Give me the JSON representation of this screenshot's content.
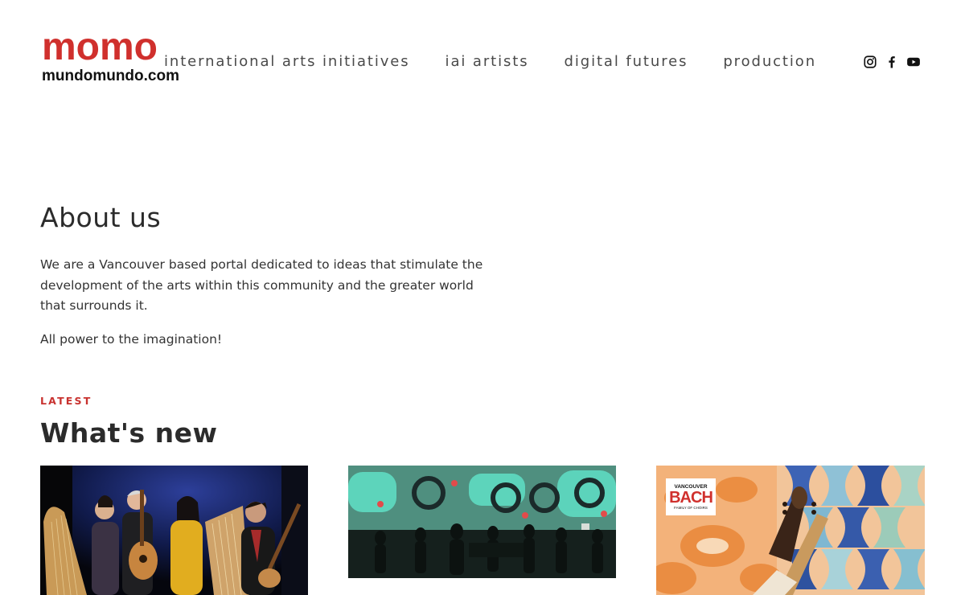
{
  "header": {
    "logo_mark": "momo",
    "logo_sub": "mundomundo.com",
    "nav": [
      {
        "label": "international arts initiatives"
      },
      {
        "label": "iai artists"
      },
      {
        "label": "digital futures"
      },
      {
        "label": "production"
      }
    ],
    "social": [
      {
        "icon": "instagram-icon"
      },
      {
        "icon": "facebook-icon"
      },
      {
        "icon": "youtube-icon"
      }
    ]
  },
  "about": {
    "title": "About us",
    "body": "We are a Vancouver based portal dedicated to ideas that stimulate the development of the arts within this community and the greater world that surrounds it.",
    "slogan": "All power to the imagination!"
  },
  "latest": {
    "eyebrow": "LATEST",
    "title": "What's new",
    "cards": [
      {
        "image": "musicians-with-harps-and-guitars-photo"
      },
      {
        "image": "dancers-in-projection-room-photo"
      },
      {
        "image": "vancouver-bach-poster-image",
        "badge_top": "VANCOUVER",
        "badge_main": "BACH",
        "badge_bottom": "FAMILY OF CHOIRS"
      }
    ]
  },
  "colors": {
    "brand_red": "#d0302d",
    "text": "#333333",
    "nav_text": "#4a4a4a"
  }
}
